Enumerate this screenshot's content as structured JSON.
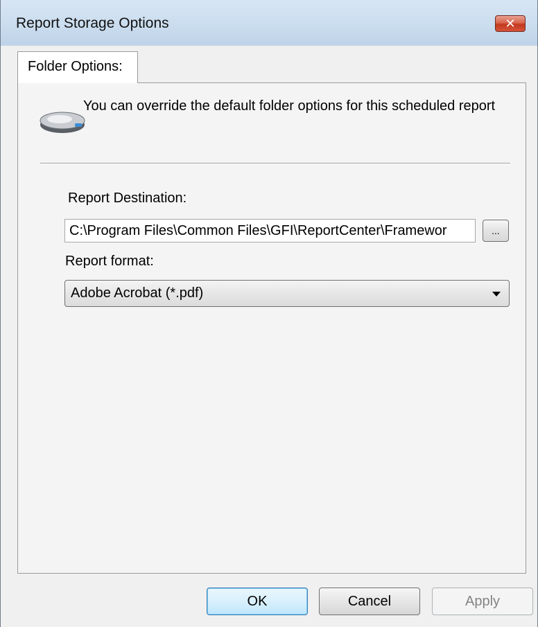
{
  "window": {
    "title": "Report Storage Options",
    "close_glyph": "✕"
  },
  "tabs": [
    {
      "label": "Folder Options:",
      "selected": true
    }
  ],
  "panel": {
    "icon": "hard-drive-icon",
    "info_text": "You can override the default folder options for this scheduled report",
    "destination_label": "Report Destination:",
    "destination_value": "C:\\Program Files\\Common Files\\GFI\\ReportCenter\\Framewor",
    "browse_label": "...",
    "format_label": "Report format:",
    "format_value": "Adobe Acrobat (*.pdf)"
  },
  "buttons": {
    "ok": "OK",
    "cancel": "Cancel",
    "apply": "Apply",
    "apply_enabled": false
  },
  "colors": {
    "close_button": "#c2391e",
    "default_button_border": "#3c7fb1",
    "disabled_text": "#838383"
  }
}
